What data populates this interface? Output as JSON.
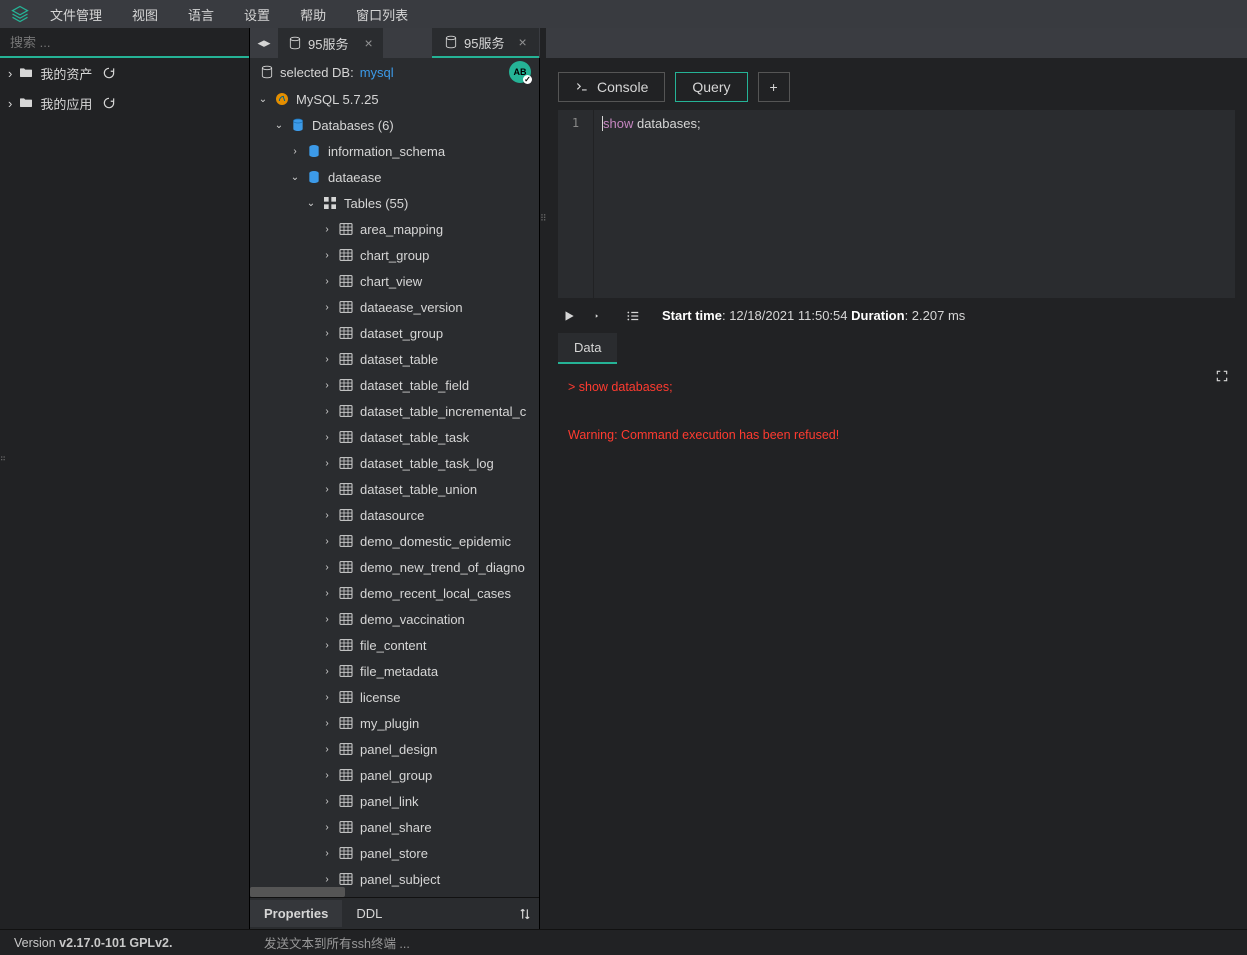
{
  "menu": {
    "file": "文件管理",
    "view": "视图",
    "lang": "语言",
    "settings": "设置",
    "help": "帮助",
    "winlist": "窗口列表"
  },
  "left": {
    "search_ph": "搜索 ...",
    "assets": "我的资产",
    "apps": "我的应用"
  },
  "dbtabs": {
    "t1": "95服务",
    "t2": "95服务"
  },
  "sel_db_label": "selected DB:",
  "sel_db_val": "mysql",
  "badge": "AB",
  "tree": {
    "server": "MySQL 5.7.25",
    "dbs_label": "Databases (6)",
    "db1": "information_schema",
    "db2": "dataease",
    "tables_label": "Tables (55)",
    "tables": [
      "area_mapping",
      "chart_group",
      "chart_view",
      "dataease_version",
      "dataset_group",
      "dataset_table",
      "dataset_table_field",
      "dataset_table_incremental_c",
      "dataset_table_task",
      "dataset_table_task_log",
      "dataset_table_union",
      "datasource",
      "demo_domestic_epidemic",
      "demo_new_trend_of_diagno",
      "demo_recent_local_cases",
      "demo_vaccination",
      "file_content",
      "file_metadata",
      "license",
      "my_plugin",
      "panel_design",
      "panel_group",
      "panel_link",
      "panel_share",
      "panel_store",
      "panel_subject"
    ]
  },
  "bottabs": {
    "prop": "Properties",
    "ddl": "DDL"
  },
  "rtool": {
    "console": "Console",
    "query": "Query",
    "plus": "+"
  },
  "editor": {
    "line": "1",
    "kw": "show",
    "rest": " databases;"
  },
  "run": {
    "start_lbl": "Start time",
    "start_val": ": 12/18/2021 11:50:54 ",
    "dur_lbl": "Duration",
    "dur_val": ": 2.207 ms"
  },
  "result": {
    "tab": "Data",
    "line1": "> show databases;",
    "line2": "Warning: Command execution has been refused!"
  },
  "status": {
    "ver_lbl": "Version ",
    "ver_val": "v2.17.0-101 GPLv2.",
    "hint": "发送文本到所有ssh终端 ..."
  }
}
